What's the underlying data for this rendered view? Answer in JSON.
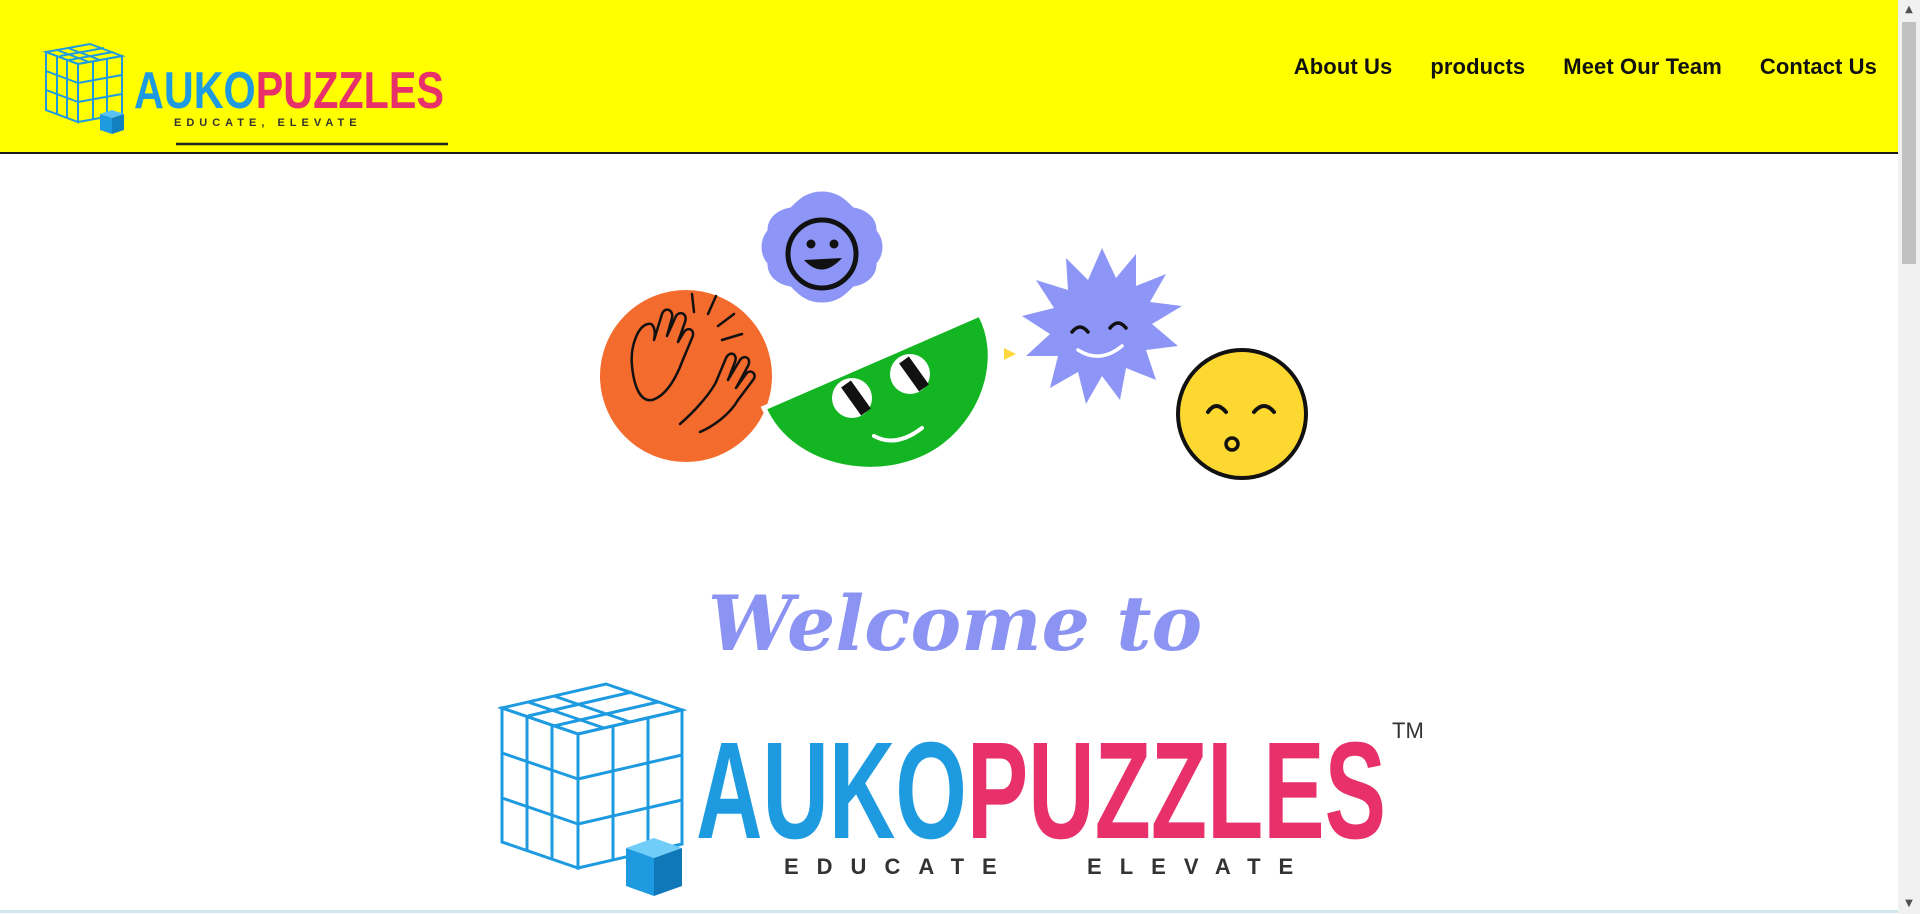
{
  "header": {
    "brand": {
      "name_part_1": "AUKO",
      "name_part_2": "PUZZLES",
      "tagline": "EDUCATE, ELEVATE"
    },
    "nav": [
      {
        "label": "About Us"
      },
      {
        "label": "products"
      },
      {
        "label": "Meet Our Team"
      },
      {
        "label": "Contact Us"
      }
    ]
  },
  "hero": {
    "welcome": "Welcome to",
    "brand_name_part_1": "AUKO",
    "brand_name_part_2": "PUZZLES",
    "trademark": "TM",
    "tagline": "EDUCATE   ELEVATE"
  },
  "colors": {
    "header_bg": "#ffff00",
    "welcome": "#8b93f3",
    "brand_blue": "#1e9be0",
    "emoji_orange": "#f36b2d",
    "emoji_lavender": "#8d96f6",
    "emoji_green": "#14b522",
    "emoji_yellow": "#fdd830"
  },
  "icons": [
    "cube-puzzle-icon",
    "clapping-hands-icon",
    "smiley-face-icon",
    "scrollbar-up-arrow-icon",
    "scrollbar-down-arrow-icon"
  ]
}
